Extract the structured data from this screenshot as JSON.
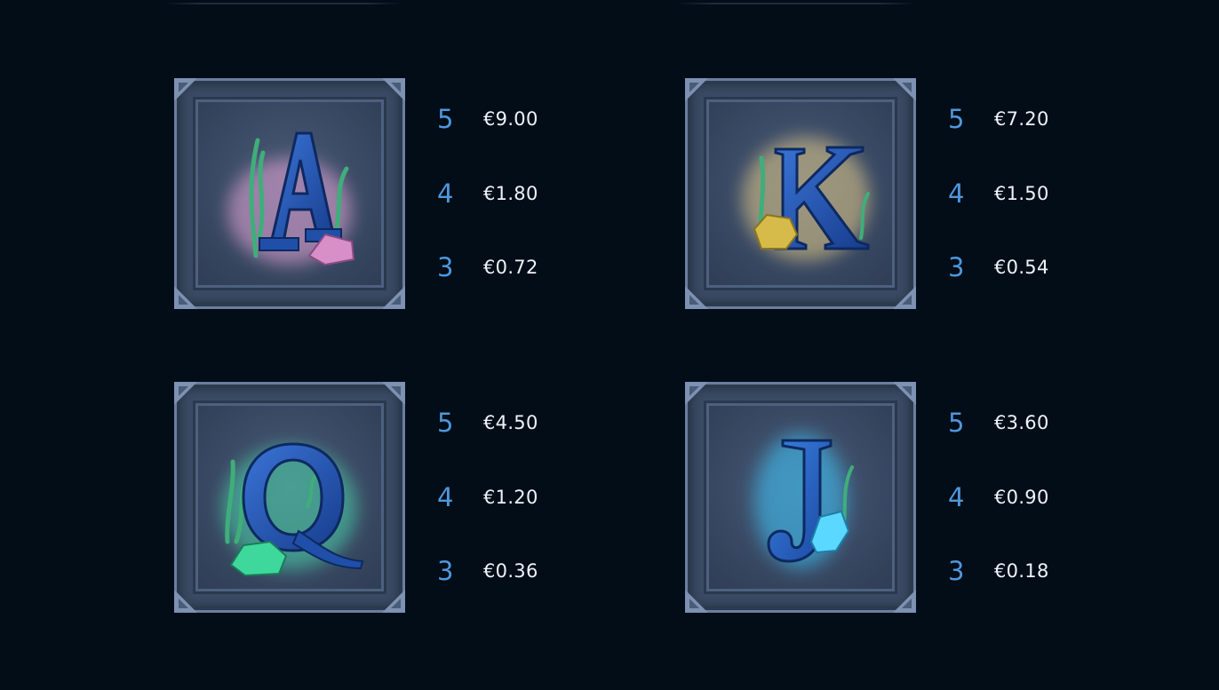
{
  "symbols": [
    {
      "letter": "A",
      "glow": "#e8a6d8",
      "gem": "#d88fc8",
      "payouts": [
        {
          "count": "5",
          "value": "€9.00"
        },
        {
          "count": "4",
          "value": "€1.80"
        },
        {
          "count": "3",
          "value": "€0.72"
        }
      ]
    },
    {
      "letter": "K",
      "glow": "#f2d48a",
      "gem": "#d6bb4a",
      "payouts": [
        {
          "count": "5",
          "value": "€7.20"
        },
        {
          "count": "4",
          "value": "€1.50"
        },
        {
          "count": "3",
          "value": "€0.54"
        }
      ]
    },
    {
      "letter": "Q",
      "glow": "#49e0b0",
      "gem": "#3fd89c",
      "payouts": [
        {
          "count": "5",
          "value": "€4.50"
        },
        {
          "count": "4",
          "value": "€1.20"
        },
        {
          "count": "3",
          "value": "€0.36"
        }
      ]
    },
    {
      "letter": "J",
      "glow": "#3ec8ff",
      "gem": "#5ad8ff",
      "payouts": [
        {
          "count": "5",
          "value": "€3.60"
        },
        {
          "count": "4",
          "value": "€0.90"
        },
        {
          "count": "3",
          "value": "€0.18"
        }
      ]
    }
  ],
  "colors": {
    "background": "#020d18",
    "count": "#4f97dc",
    "value": "#eef3f8",
    "letter": "#1f4fa8",
    "seaweed": "#3fae7a"
  }
}
